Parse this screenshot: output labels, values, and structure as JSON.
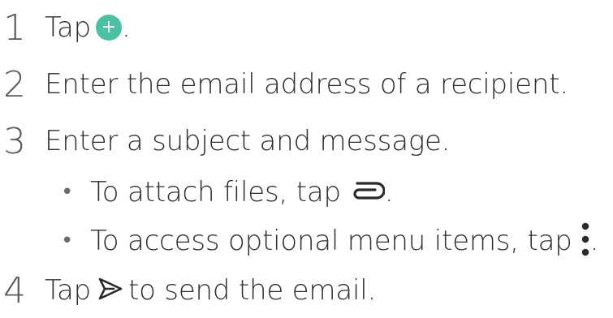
{
  "steps": [
    {
      "number": "1",
      "text_before": "Tap",
      "icon": "add-icon",
      "icon_color": "#4bc1a4",
      "icon_glyph": "+",
      "text_after": "."
    },
    {
      "number": "2",
      "text": "Enter the email address of a recipient."
    },
    {
      "number": "3",
      "text": "Enter a subject and message."
    },
    {
      "number": "4",
      "text_before": "Tap",
      "icon": "send-icon",
      "text_after": "to send the email."
    }
  ],
  "sub_items": [
    {
      "bullet": "•",
      "text_before": "To attach files, tap",
      "icon": "attach-icon",
      "text_after": "."
    },
    {
      "bullet": "•",
      "text_before": "To access optional menu items, tap",
      "icon": "more-options-icon",
      "text_after": "."
    }
  ]
}
